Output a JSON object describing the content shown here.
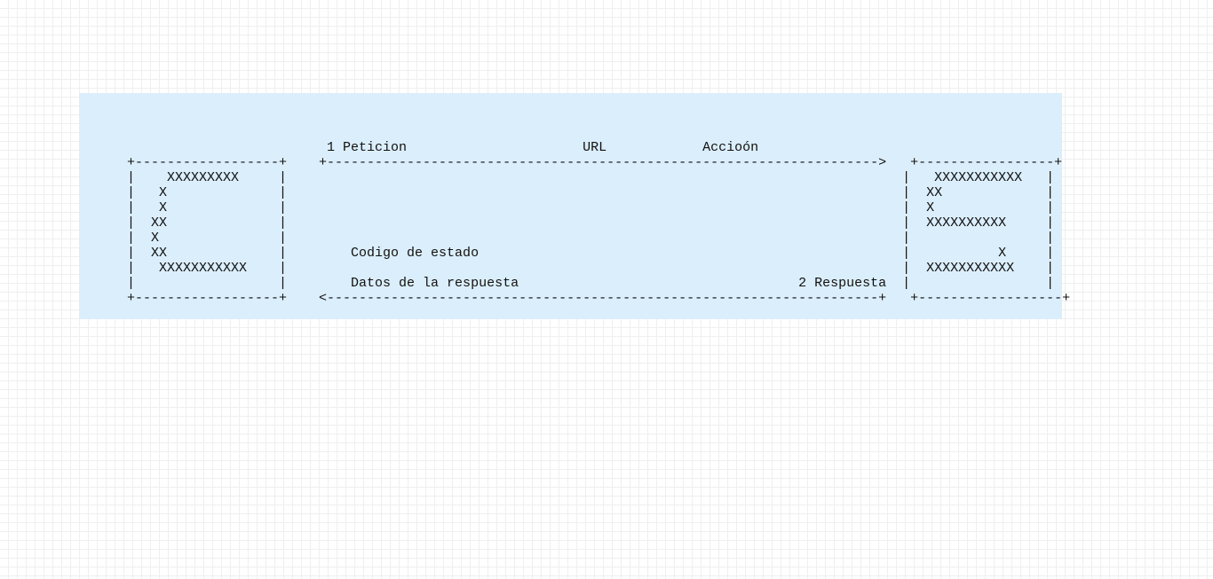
{
  "diagram": {
    "lines": [
      "                         1 Peticion                      URL            Accioón",
      "+------------------+    +--------------------------------------------------------------------->   +-----------------+",
      "|    XXXXXXXXX     |                                                                             |   XXXXXXXXXXX   |",
      "|   X              |                                                                             |  XX             |",
      "|   X              |                                                                             |  X              |",
      "|  XX              |                                                                             |  XXXXXXXXXX     |",
      "|  X               |                                                                             |                 |",
      "|  XX              |        Codigo de estado                                                     |           X     |",
      "|   XXXXXXXXXXX    |                                                                             |  XXXXXXXXXXX    |",
      "|                  |        Datos de la respuesta                                   2 Respuesta  |                 |",
      "+------------------+    <---------------------------------------------------------------------+   +------------------+"
    ]
  }
}
